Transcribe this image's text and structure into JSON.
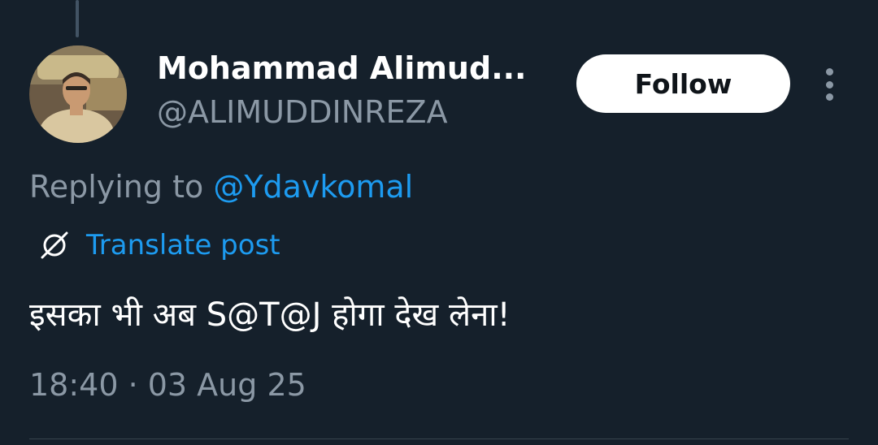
{
  "tweet": {
    "author": {
      "display_name": "Mohammad Alimud...",
      "handle": "@ALIMUDDINREZA",
      "avatar_icon": "profile-photo"
    },
    "follow_label": "Follow",
    "more_icon": "vertical-ellipsis-icon",
    "replying_prefix": "Replying to",
    "replying_to": "@Ydavkomal",
    "translate_icon": "translate-icon",
    "translate_label": "Translate post",
    "text": "इसका भी अब S@T@J होगा देख लेना!",
    "timestamp": "18:40 · 03 Aug 25"
  },
  "colors": {
    "background": "#15202b",
    "accent": "#1d9bf0",
    "secondary_text": "#8b98a5",
    "primary_text": "#ffffff"
  }
}
